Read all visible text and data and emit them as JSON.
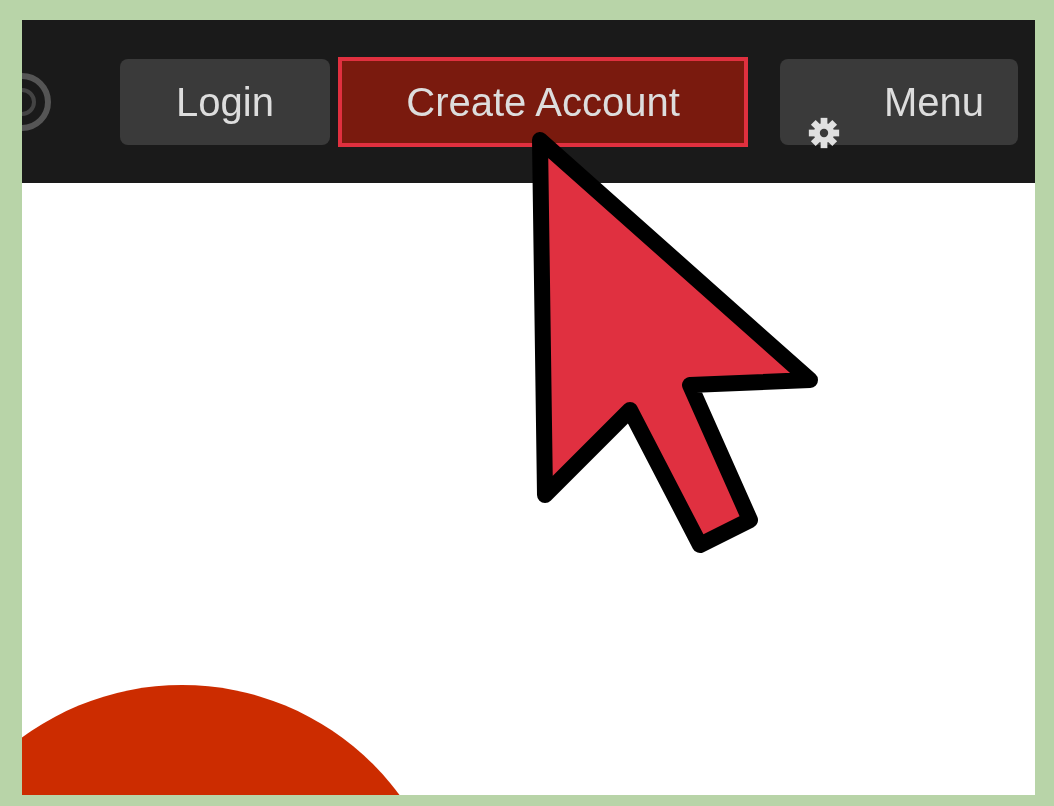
{
  "header": {
    "buttons": [
      {
        "label": "Login",
        "selected": false,
        "kind": "plain"
      },
      {
        "label": "Create Account",
        "selected": true,
        "kind": "plain"
      },
      {
        "label": "Menu",
        "selected": false,
        "kind": "menu"
      }
    ]
  }
}
